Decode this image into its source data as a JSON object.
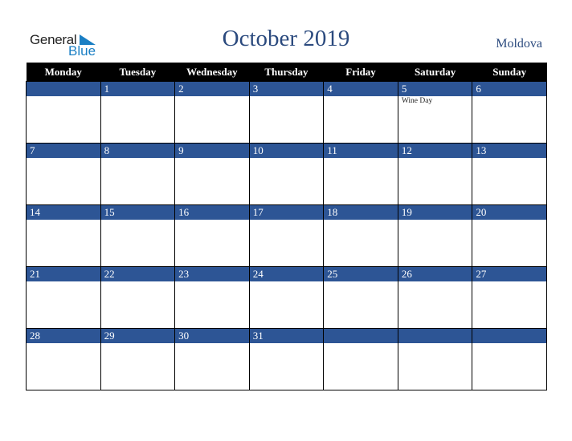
{
  "logo": {
    "line1": "General",
    "line2": "Blue"
  },
  "title": "October 2019",
  "country": "Moldova",
  "colors": {
    "header_bg": "#000000",
    "band_bg": "#2d5595",
    "title": "#2b4a7e",
    "logo_blue": "#1a7fc4"
  },
  "weekdays": [
    "Monday",
    "Tuesday",
    "Wednesday",
    "Thursday",
    "Friday",
    "Saturday",
    "Sunday"
  ],
  "weeks": [
    {
      "days": [
        "",
        "1",
        "2",
        "3",
        "4",
        "5",
        "6"
      ],
      "events": [
        "",
        "",
        "",
        "",
        "",
        "Wine Day",
        ""
      ]
    },
    {
      "days": [
        "7",
        "8",
        "9",
        "10",
        "11",
        "12",
        "13"
      ],
      "events": [
        "",
        "",
        "",
        "",
        "",
        "",
        ""
      ]
    },
    {
      "days": [
        "14",
        "15",
        "16",
        "17",
        "18",
        "19",
        "20"
      ],
      "events": [
        "",
        "",
        "",
        "",
        "",
        "",
        ""
      ]
    },
    {
      "days": [
        "21",
        "22",
        "23",
        "24",
        "25",
        "26",
        "27"
      ],
      "events": [
        "",
        "",
        "",
        "",
        "",
        "",
        ""
      ]
    },
    {
      "days": [
        "28",
        "29",
        "30",
        "31",
        "",
        "",
        ""
      ],
      "events": [
        "",
        "",
        "",
        "",
        "",
        "",
        ""
      ]
    }
  ]
}
